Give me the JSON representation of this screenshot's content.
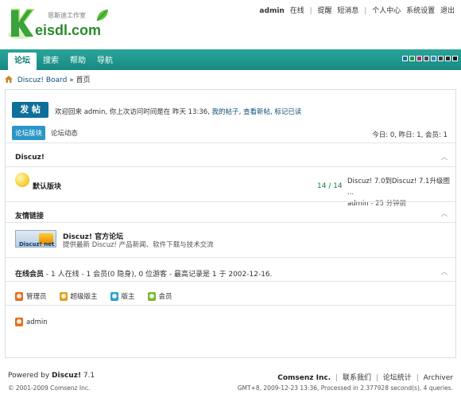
{
  "header": {
    "logo_text": "eisdl.com",
    "logo_sub": "恩斯迪工作室",
    "top_nav": {
      "user": "admin",
      "status": "在线",
      "items": [
        "提醒",
        "短消息",
        "个人中心",
        "系统设置",
        "退出"
      ]
    }
  },
  "menu": {
    "items": [
      "论坛",
      "搜索",
      "帮助",
      "导航"
    ],
    "active_index": 0,
    "theme_swatches": [
      "#1d6ea0",
      "#2a8f3c",
      "#9a2f6e",
      "#4a4a4a",
      "#3a7fc1",
      "#3a3a3a",
      "#2a2a2a",
      "#1a1a1a"
    ]
  },
  "breadcrumb": {
    "board": "Discuz! Board",
    "separator": "»",
    "current": "首页"
  },
  "main": {
    "post_button": "发 帖",
    "welcome_prefix": "欢迎回来 admin, 你上次访问时间是在 昨天 13:36,",
    "welcome_links": [
      "我的帖子",
      "查看新帖",
      "标记已读"
    ],
    "tabs": [
      "论坛版块",
      "论坛动态"
    ],
    "stats": "今日: 0, 昨日: 1, 会员: 1",
    "category_title": "Discuz!",
    "forum": {
      "name": "默认版块",
      "count": "14 / 14",
      "last_post_title": "Discuz! 7.0到Discuz! 7.1升级图 ...",
      "last_post_user": "admin",
      "last_post_time": "- 25 分钟前"
    },
    "links_title": "友情链接",
    "friend_link": {
      "logo_text": "Discuz! net",
      "title": "Discuz! 官方论坛",
      "desc": "提供最新 Discuz! 产品新闻、软件下载与技术交流"
    },
    "online": {
      "title": "在线会员",
      "text": "- 1 人在线 - 1 会员(0 隐身), 0 位游客 - 最高记录是  1 于  2002-12-16."
    },
    "legend": [
      {
        "label": "管理员",
        "color": "#e0701c"
      },
      {
        "label": "超级版主",
        "color": "#e0a020"
      },
      {
        "label": "版主",
        "color": "#2a9fd0"
      },
      {
        "label": "会员",
        "color": "#7bb52e"
      }
    ],
    "online_member": "admin",
    "online_member_color": "#e0701c"
  },
  "footer": {
    "powered_prefix": "Powered by",
    "powered_name": "Discuz!",
    "powered_version": "7.1",
    "copyright": "© 2001-2009 Comsenz Inc.",
    "company": "Comsenz Inc.",
    "links": [
      "联系我们",
      "论坛统计",
      "Archiver"
    ],
    "debug": "GMT+8, 2009-12-23 13:36, Processed in 2.377928 second(s), 4 queries."
  }
}
